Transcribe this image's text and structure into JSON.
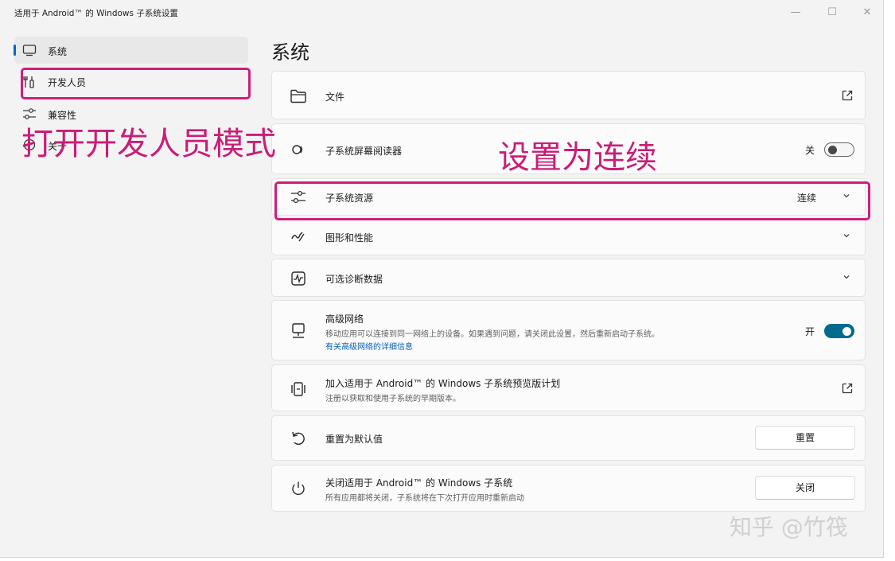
{
  "window": {
    "title": "适用于 Android™ 的 Windows 子系统设置",
    "controls": {
      "minimize": "—",
      "maximize": "☐",
      "close": "✕"
    }
  },
  "sidebar": {
    "items": [
      {
        "label": "系统",
        "icon": "monitor-icon",
        "selected": true
      },
      {
        "label": "开发人员",
        "icon": "developer-tools-icon",
        "selected": false
      },
      {
        "label": "兼容性",
        "icon": "sliders-icon",
        "selected": false
      },
      {
        "label": "关于",
        "icon": "info-icon",
        "selected": false
      }
    ]
  },
  "main": {
    "title": "系统",
    "cards": [
      {
        "id": "files",
        "title": "文件",
        "icon": "folder-icon",
        "action": "external-link-icon"
      },
      {
        "id": "screen-reader",
        "title": "子系统屏幕阅读器",
        "icon": "screen-reader-icon",
        "state_text": "关",
        "toggle": "off"
      },
      {
        "id": "resources",
        "title": "子系统资源",
        "icon": "sliders-icon",
        "value": "连续",
        "action": "chevron-down-icon"
      },
      {
        "id": "graphics",
        "title": "图形和性能",
        "icon": "graphics-icon",
        "action": "chevron-down-icon"
      },
      {
        "id": "diagnostics",
        "title": "可选诊断数据",
        "icon": "diagnostics-icon",
        "action": "chevron-down-icon"
      },
      {
        "id": "advanced-network",
        "title": "高级网络",
        "icon": "network-icon",
        "description": "移动应用可以连接到同一网络上的设备。如果遇到问题，请关闭此设置，然后重新启动子系统。",
        "link": "有关高级网络的详细信息",
        "state_text": "开",
        "toggle": "on"
      },
      {
        "id": "preview",
        "title": "加入适用于 Android™ 的 Windows 子系统预览版计划",
        "icon": "preview-icon",
        "description": "注册以获取和使用子系统的早期版本。",
        "action": "external-link-icon"
      },
      {
        "id": "reset",
        "title": "重置为默认值",
        "icon": "reset-icon",
        "button": "重置"
      },
      {
        "id": "shutdown",
        "title": "关闭适用于 Android™ 的 Windows 子系统",
        "icon": "power-icon",
        "description": "所有应用都将关闭，子系统将在下次打开应用时重新启动",
        "button": "关闭"
      }
    ]
  },
  "annotations": {
    "developer_mode": "打开开发人员模式",
    "set_continuous": "设置为连续",
    "color": "#c81e78"
  },
  "watermark": "知乎 @竹筏",
  "colors": {
    "accent": "#0067c0",
    "toggle_on": "#006b8f",
    "link": "#005fb8"
  }
}
